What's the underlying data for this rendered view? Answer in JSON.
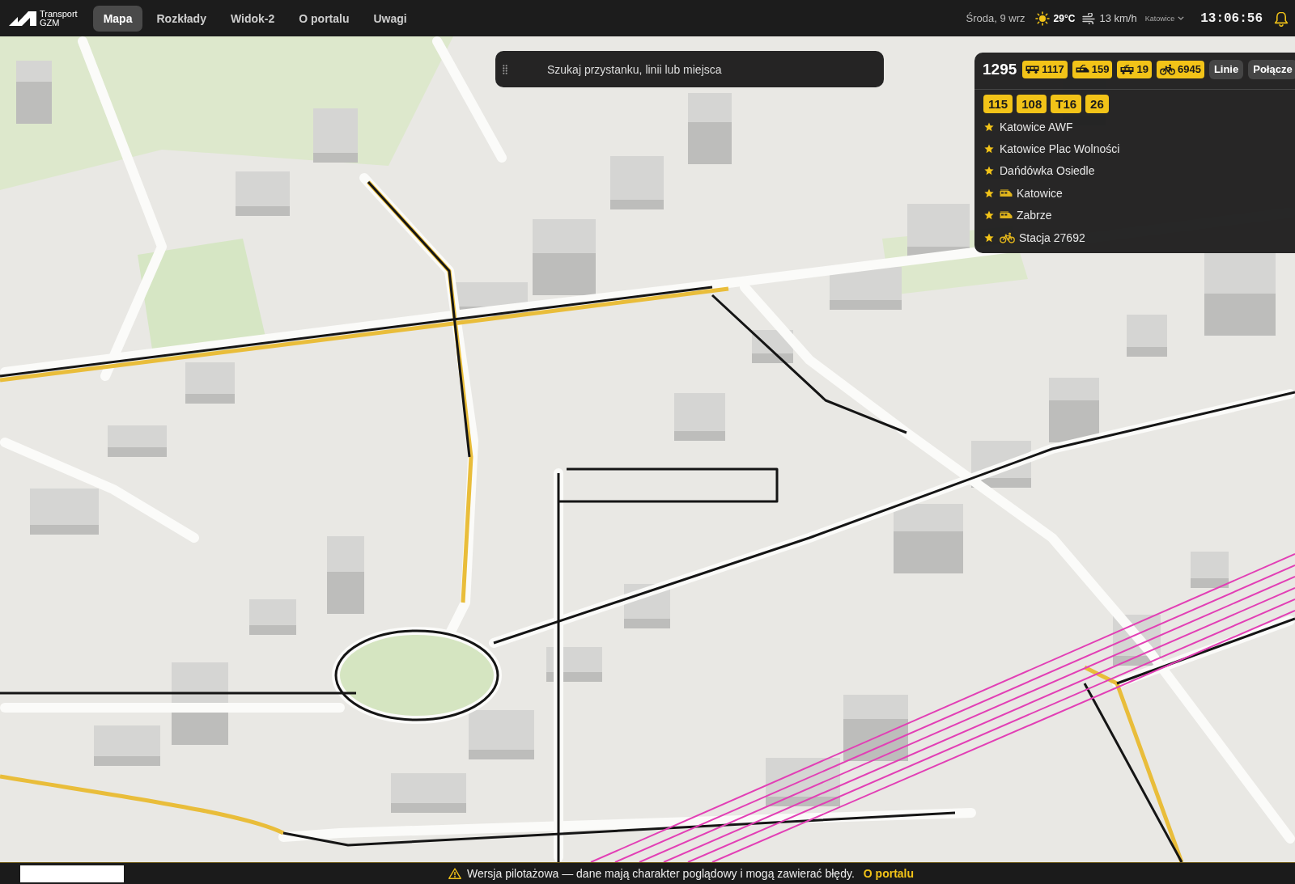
{
  "header": {
    "logo": {
      "line_1": "Transport",
      "line_2": "GZM"
    },
    "tabs": [
      {
        "label": "Mapa",
        "selected": true
      },
      {
        "label": "Rozkłady",
        "selected": false
      },
      {
        "label": "Widok-2",
        "selected": false
      },
      {
        "label": "O portalu",
        "selected": false
      },
      {
        "label": "Uwagi",
        "selected": false
      }
    ],
    "date": "Środa, 9 wrz",
    "weather": {
      "temperature": "29°C",
      "wind": "13 km/h"
    },
    "city": "Katowice",
    "clock": "13:06:56"
  },
  "search": {
    "placeholder": "Szukaj przystanku, linii lub miejsca"
  },
  "panel": {
    "total": "1295",
    "counts": [
      {
        "kind": "bus",
        "value": "1117"
      },
      {
        "kind": "tram",
        "value": "159"
      },
      {
        "kind": "trolleybus",
        "value": "19"
      },
      {
        "kind": "bike",
        "value": "6945"
      }
    ],
    "buttons": [
      "Linie",
      "Połącze"
    ],
    "favorite_lines": [
      "115",
      "108",
      "T16",
      "26"
    ],
    "favorite_places": [
      {
        "kind": "stop",
        "name": "Katowice AWF",
        "favorite": true
      },
      {
        "kind": "stop",
        "name": "Katowice Plac Wolności",
        "favorite": true
      },
      {
        "kind": "stop",
        "name": "Dańdówka Osiedle",
        "favorite": true
      },
      {
        "kind": "train",
        "name": "Katowice",
        "favorite": true
      },
      {
        "kind": "train",
        "name": "Zabrze",
        "favorite": true
      },
      {
        "kind": "bike",
        "name": "Stacja 27692",
        "favorite": true
      }
    ]
  },
  "footer": {
    "notice": "Wersja pilotażowa — dane mają charakter poglądowy i mogą zawierać błędy.",
    "link": "O portalu"
  }
}
